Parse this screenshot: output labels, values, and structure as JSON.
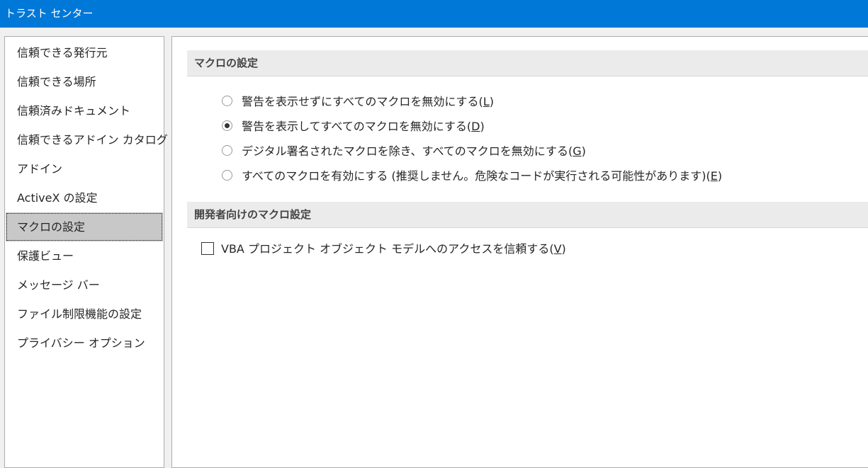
{
  "window": {
    "title": "トラスト センター"
  },
  "sidebar": {
    "items": [
      {
        "label": "信頼できる発行元"
      },
      {
        "label": "信頼できる場所"
      },
      {
        "label": "信頼済みドキュメント"
      },
      {
        "label": "信頼できるアドイン カタログ"
      },
      {
        "label": "アドイン"
      },
      {
        "label": "ActiveX の設定"
      },
      {
        "label": "マクロの設定",
        "selected": true
      },
      {
        "label": "保護ビュー"
      },
      {
        "label": "メッセージ バー"
      },
      {
        "label": "ファイル制限機能の設定"
      },
      {
        "label": "プライバシー オプション"
      }
    ]
  },
  "macro_settings": {
    "header": "マクロの設定",
    "options": [
      {
        "text": "警告を表示せずにすべてのマクロを無効にする(",
        "key": "L",
        "close": ")",
        "checked": false
      },
      {
        "text": "警告を表示してすべてのマクロを無効にする(",
        "key": "D",
        "close": ")",
        "checked": true
      },
      {
        "text": "デジタル署名されたマクロを除き、すべてのマクロを無効にする(",
        "key": "G",
        "close": ")",
        "checked": false
      },
      {
        "text": "すべてのマクロを有効にする (推奨しません。危険なコードが実行される可能性があります)(",
        "key": "E",
        "close": ")",
        "checked": false
      }
    ]
  },
  "developer_settings": {
    "header": "開発者向けのマクロ設定",
    "checkbox": {
      "text": "VBA プロジェクト オブジェクト モデルへのアクセスを信頼する(",
      "key": "V",
      "close": ")",
      "checked": false
    }
  }
}
